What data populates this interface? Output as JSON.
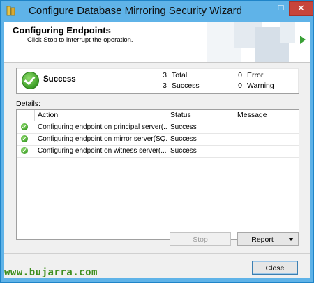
{
  "window": {
    "title": "Configure Database Mirroring Security Wizard",
    "controls": {
      "minimize": "—",
      "maximize": "□",
      "close": "✕"
    }
  },
  "header": {
    "title": "Configuring Endpoints",
    "subtitle": "Click Stop to interrupt the operation."
  },
  "summary": {
    "status": "Success",
    "total_count": "3",
    "total_label": "Total",
    "success_count": "3",
    "success_label": "Success",
    "error_count": "0",
    "error_label": "Error",
    "warning_count": "0",
    "warning_label": "Warning"
  },
  "details": {
    "label": "Details:",
    "columns": [
      "Action",
      "Status",
      "Message"
    ],
    "rows": [
      {
        "action": "Configuring endpoint on principal server(...",
        "status": "Success",
        "message": ""
      },
      {
        "action": "Configuring endpoint on mirror server(SQ...",
        "status": "Success",
        "message": ""
      },
      {
        "action": "Configuring endpoint on witness server(...",
        "status": "Success",
        "message": ""
      }
    ]
  },
  "buttons": {
    "stop": "Stop",
    "report": "Report",
    "close": "Close"
  },
  "watermark": "www.bujarra.com",
  "icons": {
    "app": "database-wizard-icon",
    "success": "success-check-icon",
    "next": "next-arrow-icon",
    "dropdown": "dropdown-arrow-icon"
  },
  "colors": {
    "titlebar": "#5fb3e8",
    "close_button": "#c7453b",
    "success_green": "#3d9e27",
    "watermark_green": "#3f8f1f"
  }
}
